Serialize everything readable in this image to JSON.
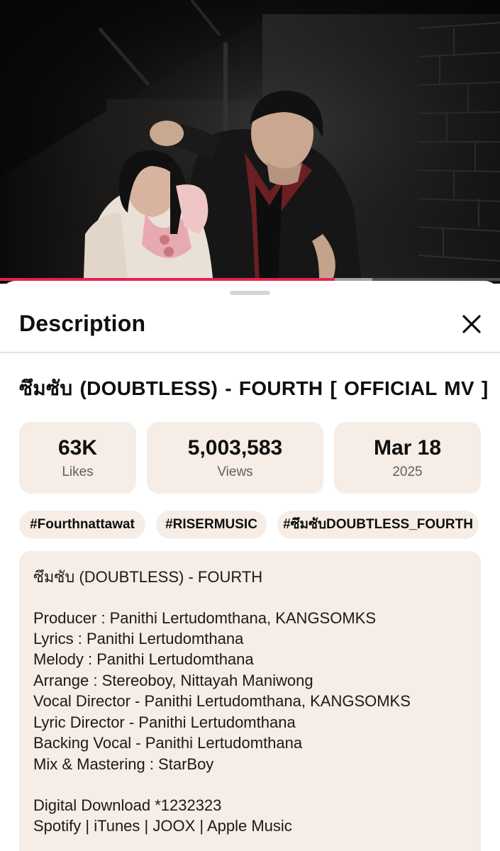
{
  "video": {
    "progress_fraction": 0.67,
    "buffered_fraction": 0.745,
    "accent_color": "#e0254f"
  },
  "sheet": {
    "title": "Description",
    "close_icon": "close-icon"
  },
  "video_title": "ซึมซับ (DOUBTLESS) - FOURTH  [ OFFICIAL MV ]",
  "stats": [
    {
      "value": "63K",
      "label": "Likes"
    },
    {
      "value": "5,003,583",
      "label": "Views"
    },
    {
      "value": "Mar 18",
      "label": "2025"
    }
  ],
  "hashtags": [
    "#Fourthnattawat",
    "#RISERMUSIC",
    "#ซึมซับDOUBTLESS_FOURTH"
  ],
  "description": {
    "lines": [
      "ซึมซับ (DOUBTLESS) - FOURTH",
      "Producer : Panithi Lertudomthana, KANGSOMKS",
      "Lyrics : Panithi Lertudomthana",
      "Melody : Panithi Lertudomthana",
      "Arrange : Stereoboy, Nittayah Maniwong",
      "Vocal Director - Panithi Lertudomthana, KANGSOMKS",
      "Lyric Director - Panithi Lertudomthana",
      "Backing Vocal - Panithi Lertudomthana",
      "Mix & Mastering : StarBoy",
      "Digital Download *1232323",
      "Spotify | iTunes | JOOX | Apple Music"
    ]
  }
}
